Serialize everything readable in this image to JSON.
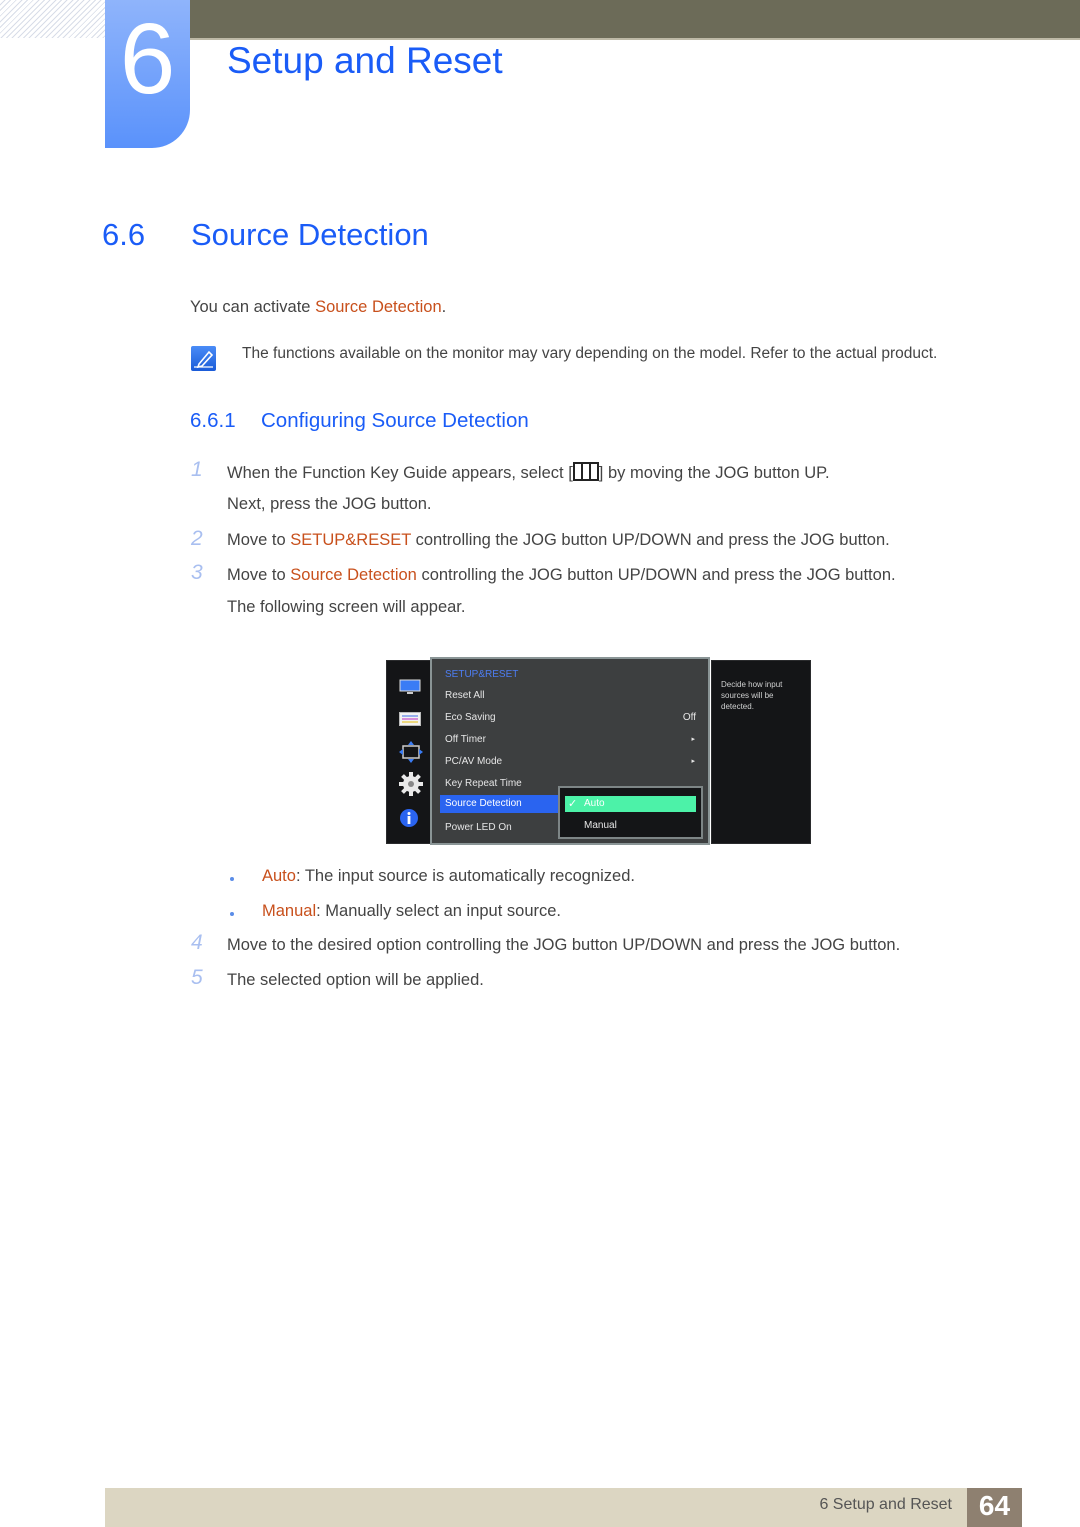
{
  "chapter": {
    "number": "6",
    "title": "Setup and Reset"
  },
  "section": {
    "number": "6.6",
    "title": "Source Detection"
  },
  "intro": {
    "prefix": "You can activate ",
    "highlight": "Source Detection",
    "suffix": "."
  },
  "note": {
    "icon": "note-pencil-icon",
    "text": "The functions available on the monitor may vary depending on the model. Refer to the actual product."
  },
  "subsection": {
    "number": "6.6.1",
    "title": "Configuring Source Detection"
  },
  "steps": [
    {
      "num": "1",
      "text_a": "When the Function Key Guide appears, select [",
      "icon": "menu-key-icon",
      "text_b": "] by moving the JOG button UP.",
      "line2": "Next, press the JOG button."
    },
    {
      "num": "2",
      "prefix": "Move to ",
      "highlight": "SETUP&RESET",
      "suffix": " controlling the JOG button UP/DOWN and press the JOG button."
    },
    {
      "num": "3",
      "prefix": "Move to ",
      "highlight": "Source Detection",
      "suffix": " controlling the JOG button UP/DOWN and press the JOG button.",
      "line2": "The following screen will appear."
    },
    {
      "num": "4",
      "text": "Move to the desired option controlling the JOG button UP/DOWN and press the JOG button."
    },
    {
      "num": "5",
      "text": "The selected option will be applied."
    }
  ],
  "osd": {
    "sidebar_icons": [
      "picture-icon",
      "onscreen-display-icon",
      "position-icon",
      "setup-gear-icon",
      "information-icon"
    ],
    "menu_title": "SETUP&RESET",
    "items": [
      {
        "label": "Reset All",
        "value": ""
      },
      {
        "label": "Eco Saving",
        "value": "Off"
      },
      {
        "label": "Off Timer",
        "value": "▸"
      },
      {
        "label": "PC/AV Mode",
        "value": "▸"
      },
      {
        "label": "Key Repeat Time",
        "value": ""
      },
      {
        "label": "Source Detection",
        "value": "",
        "selected": true
      },
      {
        "label": "Power LED On",
        "value": ""
      }
    ],
    "submenu": {
      "options": [
        "Auto",
        "Manual"
      ],
      "selected": "Auto",
      "check": "✓"
    },
    "help_text": "Decide how input sources will be detected.",
    "colors": {
      "selected_item": "#2a64f0",
      "selected_option": "#4cf2a8",
      "title": "#4d7df2"
    }
  },
  "options_desc": [
    {
      "term": "Auto",
      "desc": ": The input source is automatically recognized."
    },
    {
      "term": "Manual",
      "desc": ": Manually select an input source."
    }
  ],
  "footer": {
    "label": "6 Setup and Reset",
    "page": "64"
  },
  "colors": {
    "heading": "#1a5cf7",
    "highlight": "#c8501c",
    "topbar": "#6c6b58",
    "footer": "#dcd6c2",
    "page_box": "#8e8070"
  }
}
